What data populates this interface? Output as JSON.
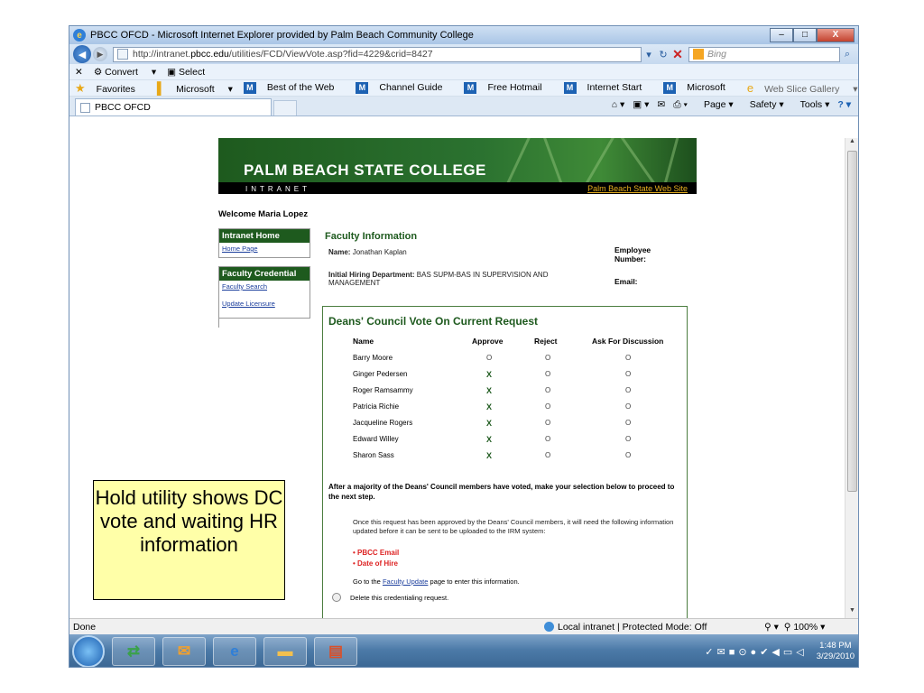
{
  "window": {
    "title": "PBCC OFCD - Microsoft Internet Explorer provided by Palm Beach Community College",
    "min_label": "–",
    "max_label": "□",
    "close_label": "X"
  },
  "address": {
    "url_prefix": "http://intranet.",
    "url_domain": "pbcc.edu",
    "url_path": "/utilities/FCD/ViewVote.asp?fid=4229&crid=8427",
    "search_placeholder": "Bing"
  },
  "toolbar": {
    "convert": "Convert",
    "select": "Select"
  },
  "favorites_bar": {
    "favorites": "Favorites",
    "microsoft": "Microsoft",
    "best_of_web": "Best of the Web",
    "channel_guide": "Channel Guide",
    "free_hotmail": "Free Hotmail",
    "internet_start": "Internet Start",
    "microsoft2": "Microsoft",
    "web_slice": "Web Slice Gallery"
  },
  "tabs": {
    "active_tab": "PBCC OFCD"
  },
  "commands": {
    "page": "Page",
    "safety": "Safety",
    "tools": "Tools"
  },
  "banner": {
    "college": "PALM BEACH STATE COLLEGE",
    "intranet": "INTRANET",
    "site_link": "Palm Beach State Web Site"
  },
  "sidebar": {
    "welcome": "Welcome Maria Lopez",
    "intranet_home": "Intranet Home",
    "home_page": "Home Page",
    "faculty_credential": "Faculty Credential",
    "faculty_search": "Faculty Search",
    "update_licensure": "Update Licensure"
  },
  "faculty": {
    "heading": "Faculty Information",
    "name_label": "Name:",
    "name_value": "Jonathan Kaplan",
    "dept_label": "Initial Hiring Department:",
    "dept_value": "BAS SUPM-BAS IN SUPERVISION AND MANAGEMENT",
    "employee_number_label": "Employee Number:",
    "email_label": "Email:"
  },
  "vote": {
    "title": "Deans' Council Vote On Current Request",
    "columns": [
      "Name",
      "Approve",
      "Reject",
      "Ask For Discussion"
    ],
    "rows": [
      {
        "name": "Barry Moore",
        "approve": "O",
        "reject": "O",
        "discuss": "O"
      },
      {
        "name": "Ginger Pedersen",
        "approve": "X",
        "reject": "O",
        "discuss": "O"
      },
      {
        "name": "Roger Ramsammy",
        "approve": "X",
        "reject": "O",
        "discuss": "O"
      },
      {
        "name": "Patricia Richie",
        "approve": "X",
        "reject": "O",
        "discuss": "O"
      },
      {
        "name": "Jacqueline Rogers",
        "approve": "X",
        "reject": "O",
        "discuss": "O"
      },
      {
        "name": "Edward Willey",
        "approve": "X",
        "reject": "O",
        "discuss": "O"
      },
      {
        "name": "Sharon Sass",
        "approve": "X",
        "reject": "O",
        "discuss": "O"
      }
    ],
    "majority_text": "After a majority of the Deans' Council members have voted, make your selection below to proceed to the next step.",
    "once_text": "Once this request has been approved by the Deans' Council members, it will need the following information updated before it can be sent to be uploaded to the IRM system:",
    "required": [
      "PBCC Email",
      "Date of Hire"
    ],
    "goto_prefix": "Go to the",
    "goto_link": "Faculty Update",
    "goto_suffix": "page to enter this information.",
    "delete_text": "Delete this credentialing request."
  },
  "status": {
    "done": "Done",
    "zone": "Local intranet | Protected Mode: Off",
    "zoom": "100%"
  },
  "taskbar": {
    "time": "1:48 PM",
    "date": "3/29/2010"
  },
  "callout": {
    "text": "Hold utility shows DC vote and waiting HR information"
  }
}
